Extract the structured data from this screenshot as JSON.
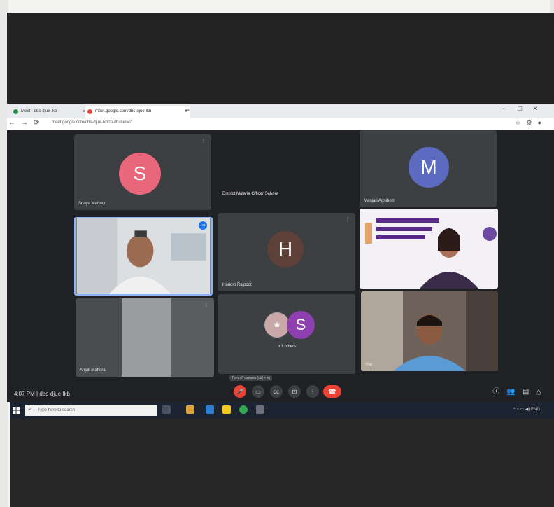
{
  "browser": {
    "tabs": [
      {
        "label": "Meet - dbs-djue-lkb"
      },
      {
        "label": "meet.google.com/dbs-djue-lkb"
      }
    ],
    "new_tab": "+",
    "url": "meet.google.com/dbs-djue-lkb?authuser=2"
  },
  "participants": [
    {
      "name": "Sonya Mahnot",
      "initial": "S",
      "avatar_color": "#e8677b"
    },
    {
      "name": "District Malaria Officer Sehore",
      "initial": "",
      "avatar_color": ""
    },
    {
      "name": "Manjari Agnihotri",
      "initial": "M",
      "avatar_color": "#5c6bc0"
    },
    {
      "name": "",
      "initial": "",
      "avatar_color": ""
    },
    {
      "name": "Hariom Rajpoot",
      "initial": "H",
      "avatar_color": "#5d4037"
    },
    {
      "name": "",
      "initial": "",
      "avatar_color": ""
    },
    {
      "name": "Anjali mahora",
      "initial": "",
      "avatar_color": ""
    },
    {
      "name": "+1 others",
      "initial": "S",
      "avatar_color": "#8e3fb0"
    },
    {
      "name": "You",
      "initial": "",
      "avatar_color": ""
    }
  ],
  "meeting": {
    "time": "4:07 PM",
    "code": "dbs-djue-lkb",
    "tooltip": "Turn off camera (ctrl + e)"
  },
  "taskbar": {
    "search_placeholder": "Type here to search"
  }
}
